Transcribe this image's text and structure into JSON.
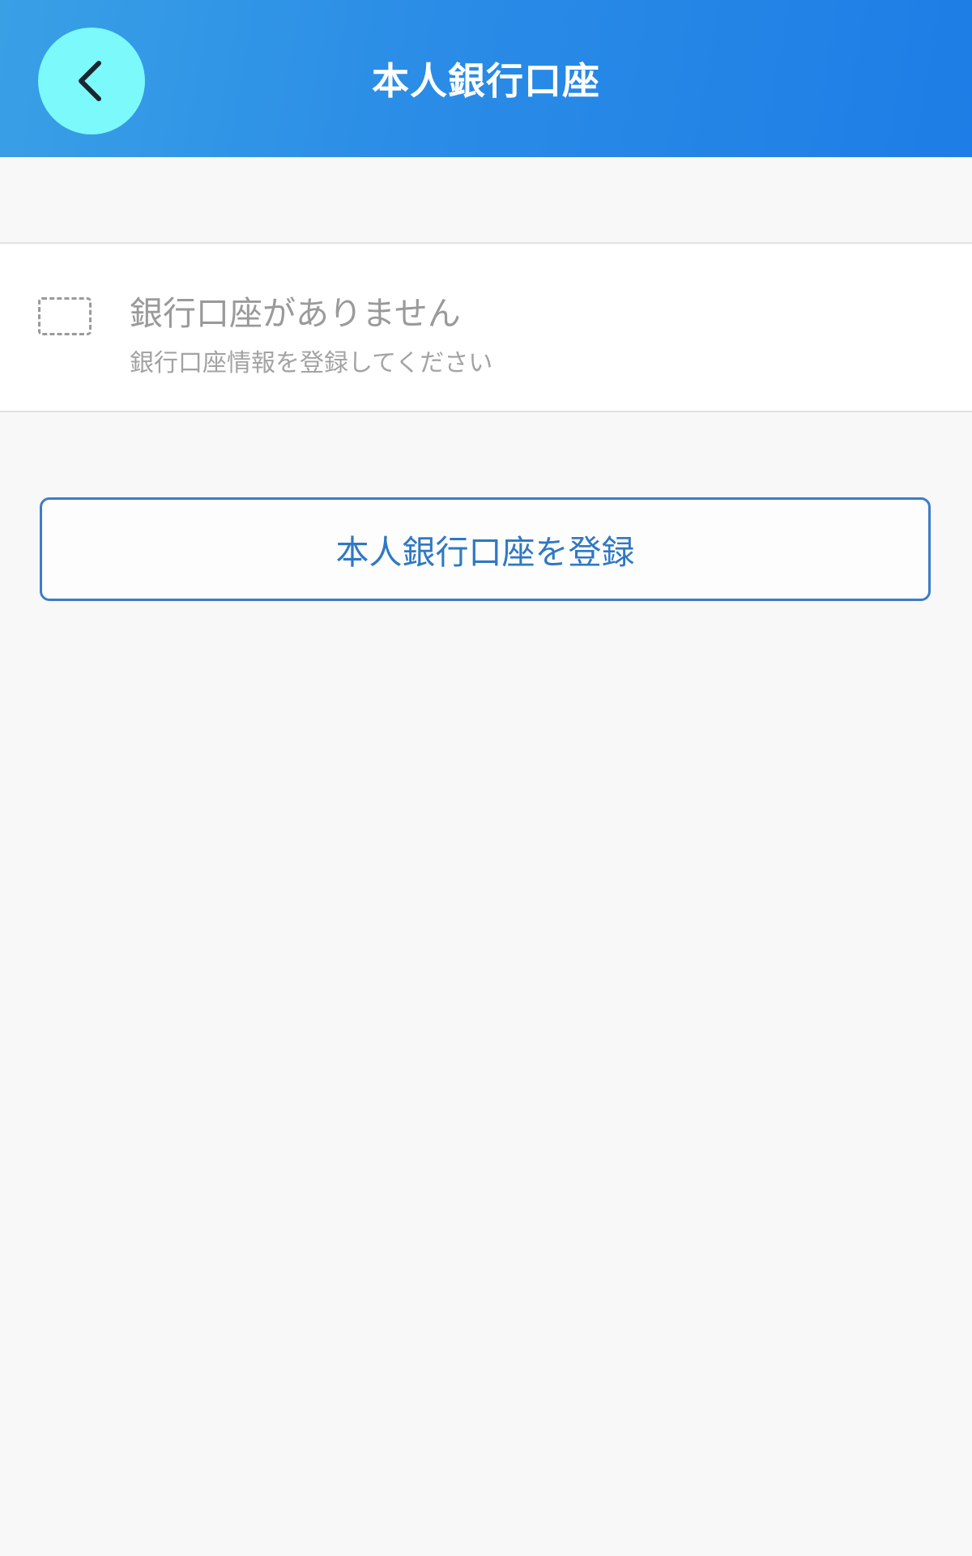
{
  "header": {
    "title": "本人銀行口座",
    "back_icon": "chevron-left-icon",
    "back_button_color": "#7cf9fb",
    "gradient_colors": [
      "#39a0e6",
      "#1e7de6"
    ]
  },
  "empty_state": {
    "icon": "dashed-card-placeholder-icon",
    "title": "銀行口座がありません",
    "subtitle": "銀行口座情報を登録してください"
  },
  "actions": {
    "register_label": "本人銀行口座を登録",
    "accent_color": "#2f78c4"
  }
}
